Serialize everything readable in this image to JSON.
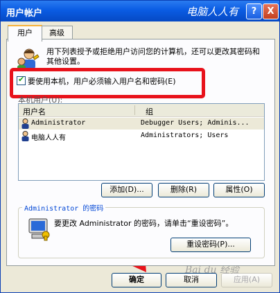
{
  "window": {
    "title": "用户帐户",
    "watermark_top": "电脑人人有",
    "help_label": "?",
    "close_label": "X"
  },
  "tabs": [
    {
      "label": "用户",
      "active": true
    },
    {
      "label": "高级",
      "active": false
    }
  ],
  "intro": {
    "text": "用下列表授予或拒绝用户访问您的计算机，还可以更改其密码和其他设置。",
    "icon": "users-icon"
  },
  "require_password": {
    "label": "要使用本机，用户必须输入用户名和密码(E)",
    "checked": true
  },
  "user_list": {
    "label": "本机用户(U):",
    "columns": [
      "用户名",
      "组"
    ],
    "rows": [
      {
        "name": "Administrator",
        "group": "Debugger Users; Adminis...",
        "selected": true
      },
      {
        "name": "电脑人人有",
        "group": "Administrators; Users",
        "selected": false
      }
    ]
  },
  "list_buttons": {
    "add": "添加(D)...",
    "remove": "删除(R)",
    "properties": "属性(O)"
  },
  "password_group": {
    "title": "Administrator 的密码",
    "text": "要更改 Administrator 的密码，请单击“重设密码”。",
    "reset_button": "重设密码(P)..."
  },
  "dialog_buttons": {
    "ok": "确定",
    "cancel": "取消",
    "apply": "应用(A)"
  },
  "watermark_bottom": "Bai du 经验",
  "colors": {
    "title_bar": "#0a5ce3",
    "highlight": "#e8121b",
    "arrow": "#e8121b"
  }
}
